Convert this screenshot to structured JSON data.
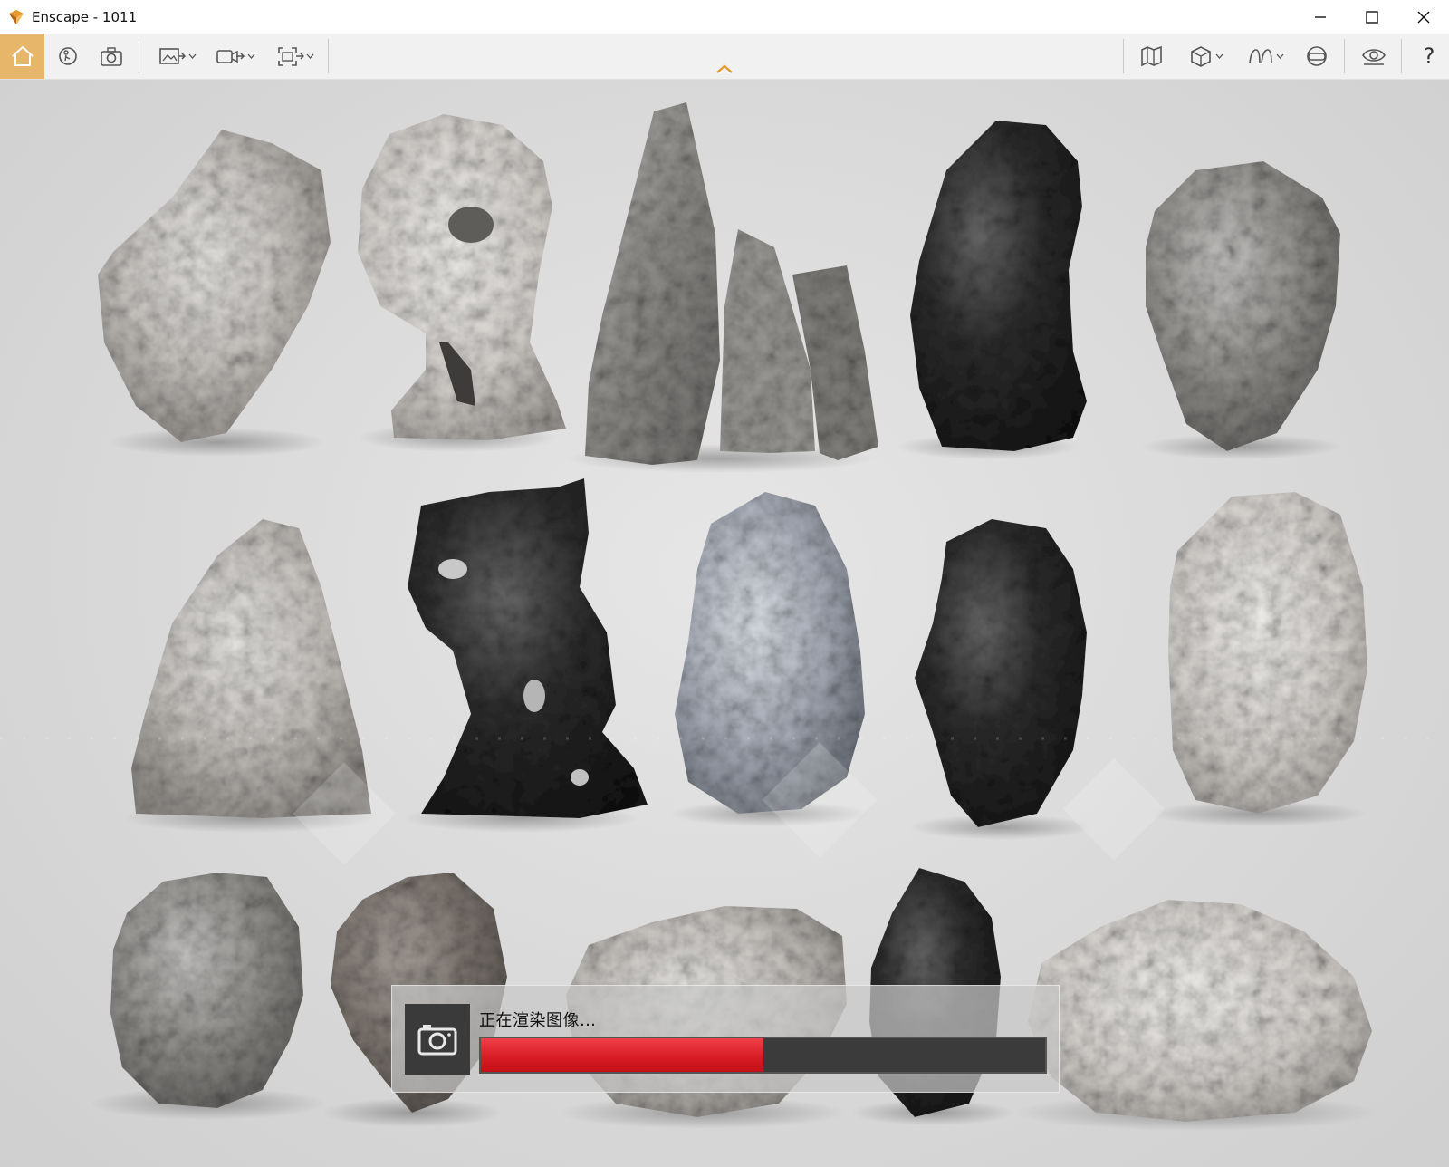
{
  "window": {
    "title": "Enscape - 1011",
    "controls": {
      "minimize_icon": "minimize-icon",
      "maximize_icon": "maximize-icon",
      "close_icon": "close-icon"
    }
  },
  "toolbar": {
    "left": [
      {
        "name": "home",
        "icon": "home-icon",
        "active": true
      },
      {
        "name": "navigation",
        "icon": "walk-rotate-icon"
      },
      {
        "name": "screenshot",
        "icon": "camera-settings-icon"
      },
      {
        "name": "export-image",
        "icon": "export-image-icon",
        "dropdown": true
      },
      {
        "name": "export-video",
        "icon": "export-video-icon",
        "dropdown": true
      },
      {
        "name": "batch-render",
        "icon": "batch-render-icon",
        "dropdown": true
      }
    ],
    "center": {
      "icon": "chevron-up-icon"
    },
    "right": [
      {
        "name": "map",
        "icon": "map-icon"
      },
      {
        "name": "asset-library",
        "icon": "cube-icon",
        "dropdown": true
      },
      {
        "name": "views",
        "icon": "views-icon",
        "dropdown": true
      },
      {
        "name": "vr",
        "icon": "vr-headset-icon"
      },
      {
        "name": "visual-settings",
        "icon": "eye-icon"
      },
      {
        "name": "help",
        "label": "?"
      }
    ]
  },
  "accent_color": "#e8b66a",
  "render_dialog": {
    "icon": "camera-icon",
    "status_text": "正在渲染图像…",
    "progress": 0.5,
    "bar_color": "#d51a23"
  }
}
